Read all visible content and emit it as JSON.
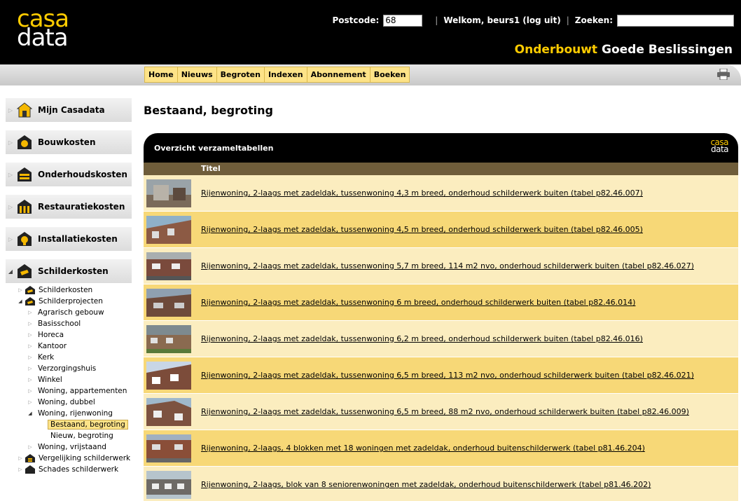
{
  "header": {
    "logo_top": "casa",
    "logo_bottom": "data",
    "postcode_label": "Postcode:",
    "postcode_value": "68",
    "welcome_prefix": "Welkom, beurs1",
    "logout": "(log uit)",
    "search_label": "Zoeken:",
    "search_value": "",
    "tagline_a": "Onderbouwt",
    "tagline_b": "Goede Beslissingen"
  },
  "nav": {
    "items": [
      "Home",
      "Nieuws",
      "Begroten",
      "Indexen",
      "Abonnement",
      "Boeken"
    ]
  },
  "sidebar": {
    "categories": [
      {
        "label": "Mijn Casadata",
        "icon": "house-icon"
      },
      {
        "label": "Bouwkosten",
        "icon": "building-costs-icon"
      },
      {
        "label": "Onderhoudskosten",
        "icon": "maintenance-icon"
      },
      {
        "label": "Restauratiekosten",
        "icon": "restoration-icon"
      },
      {
        "label": "Installatiekosten",
        "icon": "installation-icon"
      },
      {
        "label": "Schilderkosten",
        "icon": "paint-icon"
      }
    ],
    "tree": {
      "schilderkosten": "Schilderkosten",
      "schilderprojecten": "Schilderprojecten",
      "projects": [
        "Agrarisch gebouw",
        "Basisschool",
        "Horeca",
        "Kantoor",
        "Kerk",
        "Verzorgingshuis",
        "Winkel",
        "Woning, appartementen",
        "Woning, dubbel",
        "Woning, rijenwoning"
      ],
      "leaf_selected": "Bestaand, begroting",
      "leaf_new": "Nieuw, begroting",
      "after": "Woning, vrijstaand",
      "vergelijking": "Vergelijking schilderwerk",
      "schades": "Schades schilderwerk"
    }
  },
  "main": {
    "title": "Bestaand, begroting",
    "panel_title": "Overzicht verzameltabellen",
    "panel_logo_top": "casa",
    "panel_logo_bottom": "data",
    "column_title": "Titel",
    "rows": [
      "Rijenwoning, 2-laags met zadeldak, tussenwoning 4,3 m breed, onderhoud schilderwerk buiten (tabel p82.46.007)",
      "Rijenwoning, 2-laags met zadeldak, tussenwoning 4,5 m breed, onderhoud schilderwerk buiten (tabel p82.46.005)",
      "Rijenwoning, 2-laags met zadeldak, tussenwoning 5,7 m breed, 114 m2 nvo, onderhoud schilderwerk buiten (tabel p82.46.027)",
      "Rijenwoning, 2-laags met zadeldak, tussenwoning 6 m breed, onderhoud schilderwerk buiten (tabel p82.46.014)",
      "Rijenwoning, 2-laags met zadeldak, tussenwoning 6,2 m breed, onderhoud schilderwerk buiten (tabel p82.46.016)",
      "Rijenwoning, 2-laags met zadeldak, tussenwoning 6,5 m breed, 113 m2 nvo, onderhoud schilderwerk buiten (tabel p82.46.021)",
      "Rijenwoning, 2-laags met zadeldak, tussenwoning 6,5 m breed, 88 m2 nvo, onderhoud schilderwerk buiten (tabel p82.46.009)",
      "Rijenwoning, 2-laags, 4 blokken met 18 woningen met zadeldak, onderhoud buitenschilderwerk (tabel p81.46.204)",
      "Rijenwoning, 2-laags, blok van 8 seniorenwoningen met zadeldak, onderhoud buitenschilderwerk (tabel p81.46.202)"
    ]
  },
  "colors": {
    "accent": "#ffcc00",
    "row_light": "#fbedbf",
    "row_dark": "#f7d877",
    "column_header": "#6f5d3a"
  }
}
